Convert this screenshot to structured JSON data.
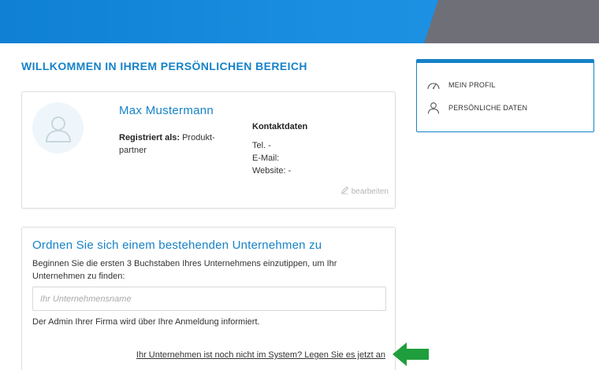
{
  "header": {
    "accent": "#1682c8",
    "gray": "#6f6f78"
  },
  "page": {
    "title": "WILLKOMMEN IN IHREM PERSÖNLICHEN BEREICH"
  },
  "profile": {
    "avatar_icon": "user-avatar-icon",
    "name": "Max Mustermann",
    "registered_label": "Registriert als:",
    "registered_value": "Produkt-partner",
    "contact_title": "Kontaktdaten",
    "phone": "Tel. -",
    "email": "E-Mail:",
    "website": "Website: -",
    "edit_label": "bearbeiten",
    "edit_icon": "pencil-icon"
  },
  "company": {
    "title": "Ordnen Sie sich einem bestehenden Unternehmen zu",
    "description": "Beginnen Sie die ersten 3 Buchstaben Ihres Unternehmens einzutippen, um Ihr Unternehmen zu finden:",
    "input_placeholder": "Ihr Unternehmensname",
    "input_value": "",
    "note": "Der Admin Ihrer Firma wird über Ihre Anmeldung informiert.",
    "register_link": "Ihr Unternehmen ist noch nicht im System? Legen Sie es jetzt an",
    "arrow_color": "#1e9e3c"
  },
  "sidebar": {
    "items": [
      {
        "label": "MEIN PROFIL",
        "icon": "speedometer-icon"
      },
      {
        "label": "PERSÖNLICHE DATEN",
        "icon": "person-icon"
      }
    ]
  }
}
